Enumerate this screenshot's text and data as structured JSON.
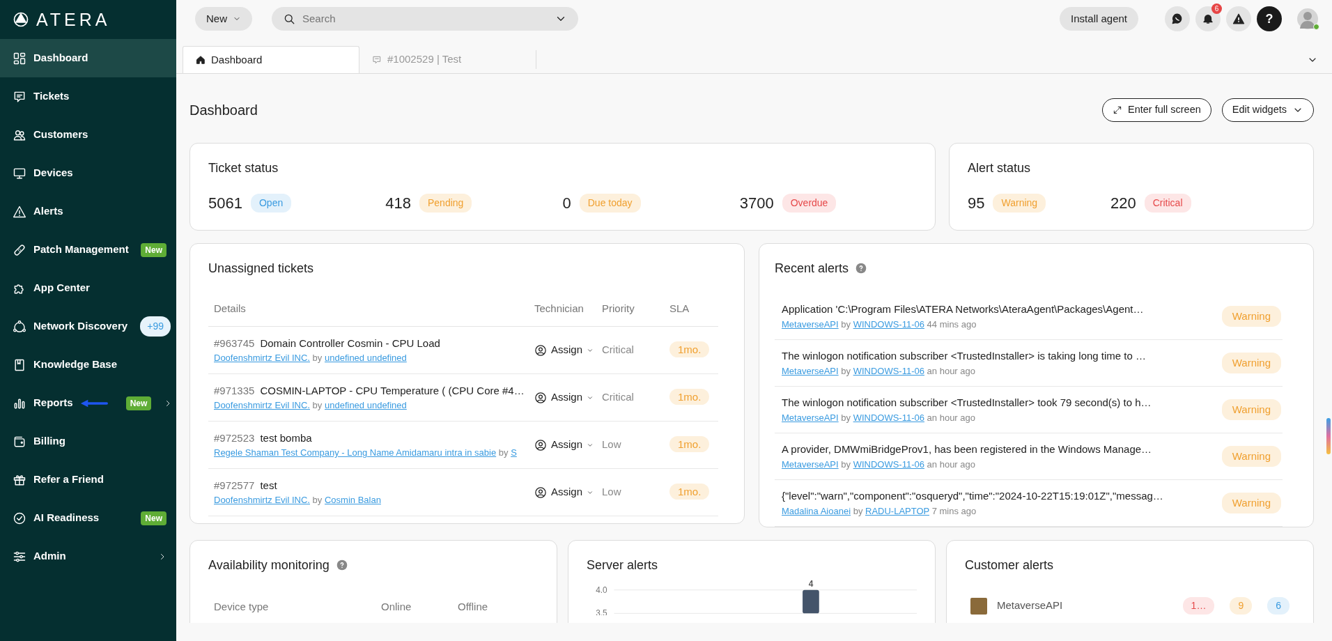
{
  "brand": {
    "name": "ATERA"
  },
  "sidebar": {
    "items": [
      {
        "label": "Dashboard",
        "selected": true
      },
      {
        "label": "Tickets",
        "selected": false
      },
      {
        "label": "Customers",
        "selected": false
      },
      {
        "label": "Devices",
        "selected": false
      },
      {
        "label": "Alerts",
        "selected": false
      },
      {
        "label": "Patch Management",
        "selected": false,
        "badge": {
          "text": "New",
          "kind": "new"
        }
      },
      {
        "label": "App Center",
        "selected": false
      },
      {
        "label": "Network Discovery",
        "selected": false,
        "badge": {
          "text": "+99",
          "kind": "count"
        }
      },
      {
        "label": "Knowledge Base",
        "selected": false
      },
      {
        "label": "Reports",
        "selected": false,
        "badge": {
          "text": "New",
          "kind": "new"
        },
        "submenu": true,
        "pointer_arrow": true
      },
      {
        "label": "Billing",
        "selected": false
      },
      {
        "label": "Refer a Friend",
        "selected": false
      },
      {
        "label": "AI Readiness",
        "selected": false,
        "badge": {
          "text": "New",
          "kind": "new"
        }
      },
      {
        "label": "Admin",
        "selected": false,
        "submenu": true
      }
    ]
  },
  "topbar": {
    "new_button": "New",
    "search": {
      "placeholder": "Search"
    },
    "install_button": "Install agent",
    "notification_count": "6",
    "help_label": "?",
    "user_online": true
  },
  "tabs": [
    {
      "label": "Dashboard",
      "selected": true
    },
    {
      "label": "#1002529 | Test",
      "selected": false
    }
  ],
  "page": {
    "title": "Dashboard",
    "fullscreen_button": "Enter full screen",
    "edit_button": "Edit widgets"
  },
  "ticket_status": {
    "title": "Ticket status",
    "items": [
      {
        "value": "5061",
        "label": "Open",
        "kind": "info"
      },
      {
        "value": "418",
        "label": "Pending",
        "kind": "warning"
      },
      {
        "value": "0",
        "label": "Due today",
        "kind": "warning"
      },
      {
        "value": "3700",
        "label": "Overdue",
        "kind": "danger"
      }
    ]
  },
  "alert_status": {
    "title": "Alert status",
    "items": [
      {
        "value": "95",
        "label": "Warning",
        "kind": "warning"
      },
      {
        "value": "220",
        "label": "Critical",
        "kind": "danger"
      }
    ]
  },
  "unassigned_tickets": {
    "title": "Unassigned tickets",
    "columns": [
      "Details",
      "Technician",
      "Priority",
      "SLA"
    ],
    "rows": [
      {
        "id": "#963745",
        "subject": "Domain Controller Cosmin - CPU Load",
        "customer": "Doofenshmirtz Evil INC.",
        "by": "by",
        "creator": "undefined undefined",
        "technician": "Assign",
        "priority": "Critical",
        "sla": "1mo."
      },
      {
        "id": "#971335",
        "subject": "COSMIN-LAPTOP - CPU Temperature ( (CPU Core #4…",
        "customer": "Doofenshmirtz Evil INC.",
        "by": "by",
        "creator": "undefined undefined",
        "technician": "Assign",
        "priority": "Critical",
        "sla": "1mo."
      },
      {
        "id": "#972523",
        "subject": "test bomba",
        "customer": "Regele Shaman Test Company - Long Name Amidamaru intra in sabie",
        "by": "by",
        "creator": "S",
        "technician": "Assign",
        "priority": "Low",
        "sla": "1mo."
      },
      {
        "id": "#972577",
        "subject": "test",
        "customer": "Doofenshmirtz Evil INC.",
        "by": "by",
        "creator": "Cosmin Balan",
        "technician": "Assign",
        "priority": "Low",
        "sla": "1mo."
      }
    ]
  },
  "recent_alerts": {
    "title": "Recent alerts",
    "rows": [
      {
        "message": "Application 'C:\\Program Files\\ATERA Networks\\AteraAgent\\Packages\\Agent…",
        "customer": "MetaverseAPI",
        "by": "by",
        "device": "WINDOWS-11-06",
        "time": "44 mins ago",
        "severity": "Warning"
      },
      {
        "message": "The winlogon notification subscriber <TrustedInstaller> is taking long time to …",
        "customer": "MetaverseAPI",
        "by": "by",
        "device": "WINDOWS-11-06",
        "time": "an hour ago",
        "severity": "Warning"
      },
      {
        "message": "The winlogon notification subscriber <TrustedInstaller> took 79 second(s) to h…",
        "customer": "MetaverseAPI",
        "by": "by",
        "device": "WINDOWS-11-06",
        "time": "an hour ago",
        "severity": "Warning"
      },
      {
        "message": "A provider, DMWmiBridgeProv1, has been registered in the Windows Manage…",
        "customer": "MetaverseAPI",
        "by": "by",
        "device": "WINDOWS-11-06",
        "time": "an hour ago",
        "severity": "Warning"
      },
      {
        "message": "{\"level\":\"warn\",\"component\":\"osqueryd\",\"time\":\"2024-10-22T15:19:01Z\",\"messag…",
        "customer": "Madalina Aioanei",
        "by": "by",
        "device": "RADU-LAPTOP",
        "time": "7 mins ago",
        "severity": "Warning"
      }
    ]
  },
  "availability": {
    "title": "Availability monitoring",
    "columns": [
      "Device type",
      "Online",
      "Offline"
    ]
  },
  "server_alerts": {
    "title": "Server alerts",
    "chart_data": {
      "type": "bar",
      "values": [
        4
      ],
      "ylim": [
        3.5,
        4
      ],
      "yticks": [
        {
          "value": 3.5,
          "label": "3.5"
        },
        {
          "value": 4,
          "label": "4.0"
        }
      ],
      "data_labels": true
    }
  },
  "customer_alerts": {
    "title": "Customer alerts",
    "rows": [
      {
        "name": "MetaverseAPI",
        "counts": [
          {
            "text": "1…",
            "kind": "danger"
          },
          {
            "text": "9",
            "kind": "warning"
          },
          {
            "text": "6",
            "kind": "info"
          }
        ]
      }
    ]
  }
}
